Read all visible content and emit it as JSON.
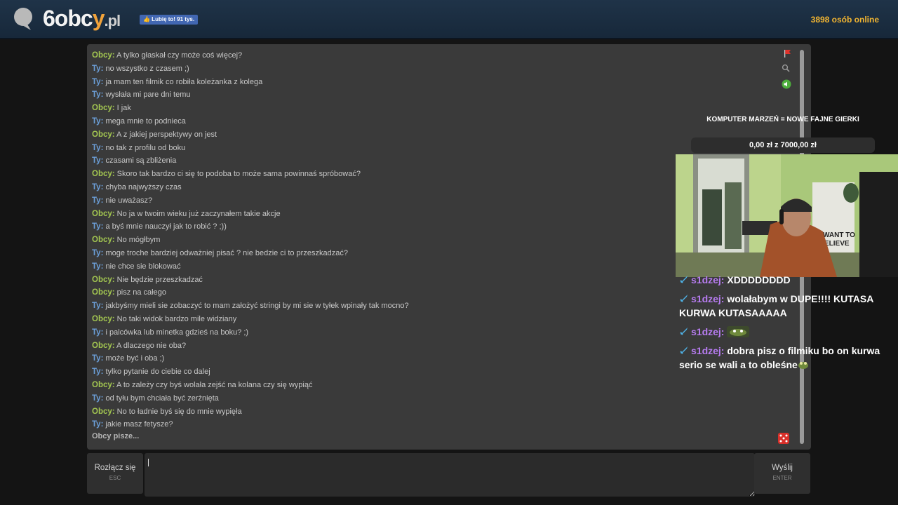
{
  "header": {
    "logo_digit": "6",
    "logo_o": "o",
    "logo_b": "b",
    "logo_c": "c",
    "logo_y": "y",
    "logo_tld": ".pl",
    "fb_like_label": "👍 Lubię to! 91 tys.",
    "online_count": "3898 osób online"
  },
  "chat": {
    "messages": [
      {
        "author": "Obcy:",
        "text": " A tylko głaskał czy może coś więcej?"
      },
      {
        "author": "Ty:",
        "text": " no wszystko z czasem ;)"
      },
      {
        "author": "Ty:",
        "text": " ja mam ten filmik co robiła koleżanka z kolega"
      },
      {
        "author": "Ty:",
        "text": " wysłała mi pare dni temu"
      },
      {
        "author": "Obcy:",
        "text": " I jak"
      },
      {
        "author": "Ty:",
        "text": " mega mnie to podnieca"
      },
      {
        "author": "Obcy:",
        "text": " A z jakiej perspektywy on jest"
      },
      {
        "author": "Ty:",
        "text": " no tak z profilu od boku"
      },
      {
        "author": "Ty:",
        "text": " czasami są zbliżenia"
      },
      {
        "author": "Obcy:",
        "text": " Skoro tak bardzo ci się to podoba to może sama powinnaś spróbować?"
      },
      {
        "author": "Ty:",
        "text": " chyba najwyższy czas"
      },
      {
        "author": "Ty:",
        "text": " nie uważasz?"
      },
      {
        "author": "Obcy:",
        "text": " No ja w twoim wieku już zaczynałem takie akcje"
      },
      {
        "author": "Ty:",
        "text": " a byś mnie nauczył jak to robić ? ;))"
      },
      {
        "author": "Obcy:",
        "text": " No mógłbym"
      },
      {
        "author": "Ty:",
        "text": " moge troche bardziej odważniej pisać ? nie bedzie ci to przeszkadzać?"
      },
      {
        "author": "Ty:",
        "text": " nie chce sie blokować"
      },
      {
        "author": "Obcy:",
        "text": " Nie będzie przeszkadzać"
      },
      {
        "author": "Obcy:",
        "text": " pisz na całego"
      },
      {
        "author": "Ty:",
        "text": " jakbyśmy mieli sie zobaczyć to mam założyć stringi by mi sie w tyłek wpinały tak mocno?"
      },
      {
        "author": "Obcy:",
        "text": " No taki widok bardzo mile widziany"
      },
      {
        "author": "Ty:",
        "text": " i palcówka lub minetka gdzieś na boku? ;)"
      },
      {
        "author": "Obcy:",
        "text": " A dlaczego nie oba?"
      },
      {
        "author": "Ty:",
        "text": " może być i oba ;)"
      },
      {
        "author": "Ty:",
        "text": " tylko pytanie do ciebie co dalej"
      },
      {
        "author": "Obcy:",
        "text": " A to zależy czy byś wolała zejść na kolana czy się wypiąć"
      },
      {
        "author": "Ty:",
        "text": " od tyłu bym chciała być zerżnięta"
      },
      {
        "author": "Obcy:",
        "text": " No to ładnie byś się do mnie wypięła"
      },
      {
        "author": "Ty:",
        "text": " jakie masz fetysze?"
      }
    ],
    "typing_indicator": "Obcy pisze...",
    "disconnect_label": "Rozłącz się",
    "disconnect_key": "ESC",
    "send_label": "Wyślij",
    "send_key": "ENTER",
    "input_value": ""
  },
  "stream_overlay": {
    "title": "KOMPUTER MARZEŃ = NOWE FAJNE GIERKI",
    "goal": "0,00 zł z 7000,00 zł",
    "poster_line1": "WANT TO",
    "poster_line2": "ELIEVE",
    "twitch_chat": [
      {
        "user": "s1dzej:",
        "text": " XDDDDDDDD"
      },
      {
        "user": "s1dzej:",
        "text": " wolałabym w DUPE!!!! KUTASA KURWA KUTASAAAAA"
      },
      {
        "user": "s1dzej:",
        "text": " ",
        "emote": "pepe-emote"
      },
      {
        "user": "s1dzej:",
        "text": " dobra pisz o filmiku bo on kurwa serio se wali a to obleśne",
        "emote": "frog-emote"
      }
    ]
  },
  "icons": {
    "report": "flag-icon",
    "search": "magnifier-icon",
    "sound": "sound-on-icon",
    "random": "dice-icon",
    "badge": "sword-badge-icon"
  },
  "colors": {
    "header_bg": "#1c2e42",
    "online_text": "#f2b531",
    "stranger_name": "#a3c651",
    "you_name": "#6c9fd8",
    "chat_bg": "#3a3a3a",
    "twitch_user": "#b77cf1"
  }
}
